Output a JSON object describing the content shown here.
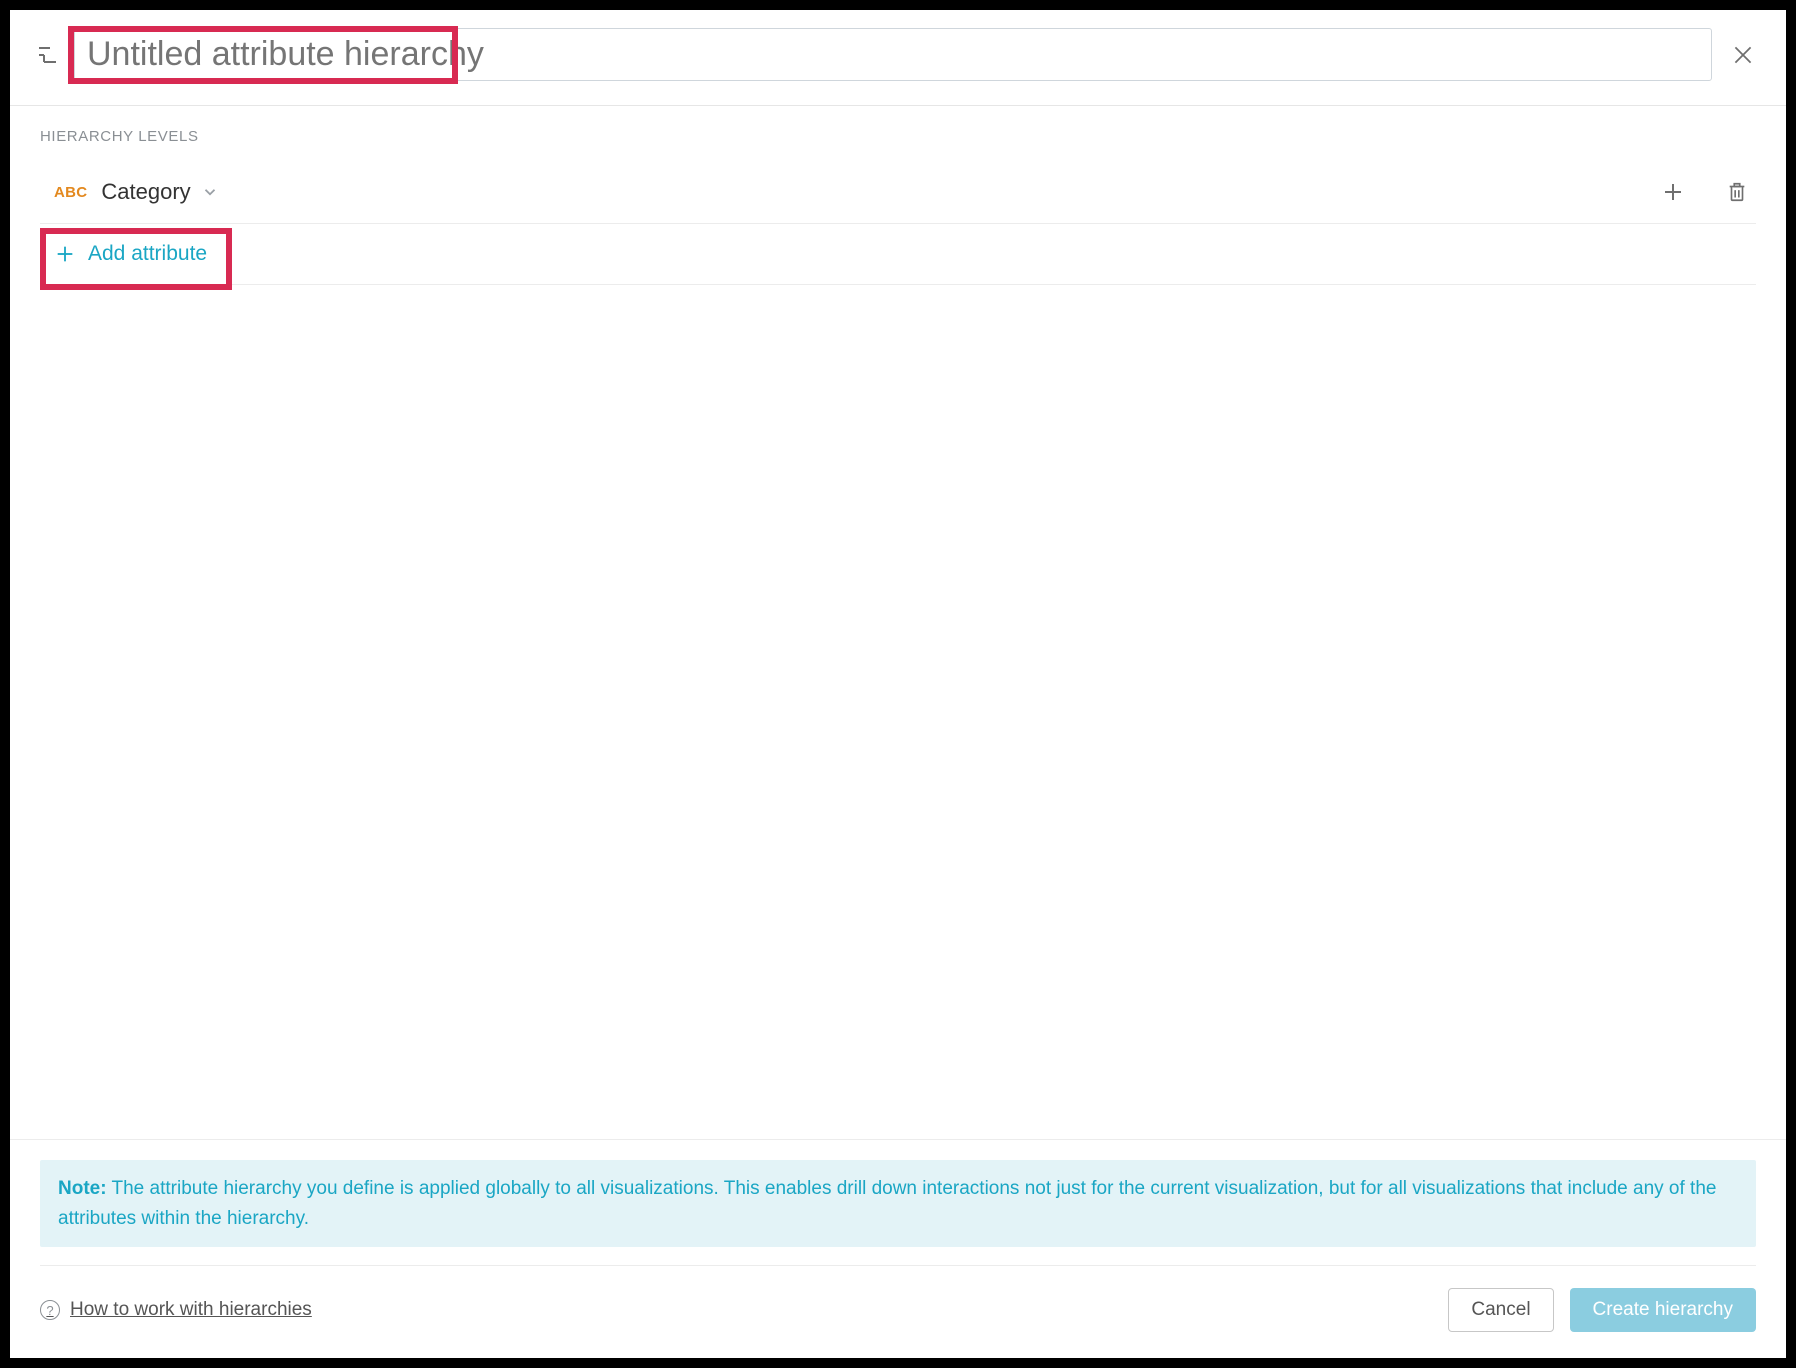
{
  "header": {
    "title_placeholder": "Untitled attribute hierarchy"
  },
  "section": {
    "label": "HIERARCHY LEVELS"
  },
  "levels": [
    {
      "type_badge": "ABC",
      "name": "Category"
    }
  ],
  "add_attribute_label": "Add attribute",
  "note": {
    "prefix": "Note:",
    "text": "The attribute hierarchy you define is applied globally to all visualizations. This enables drill down interactions not just for the current visualization, but for all visualizations that include any of the attributes within the hierarchy."
  },
  "footer": {
    "help_link": "How to work with hierarchies",
    "cancel": "Cancel",
    "create": "Create hierarchy"
  },
  "icons": {
    "hierarchy": "hierarchy-icon",
    "close": "close-icon",
    "chevron_down": "chevron-down-icon",
    "plus": "plus-icon",
    "trash": "trash-icon",
    "help": "help-icon"
  },
  "colors": {
    "accent": "#1aa6c4",
    "highlight": "#d82a52",
    "type_badge": "#e3891f",
    "note_bg": "#e3f3f7",
    "primary_btn": "#8bcde0"
  }
}
